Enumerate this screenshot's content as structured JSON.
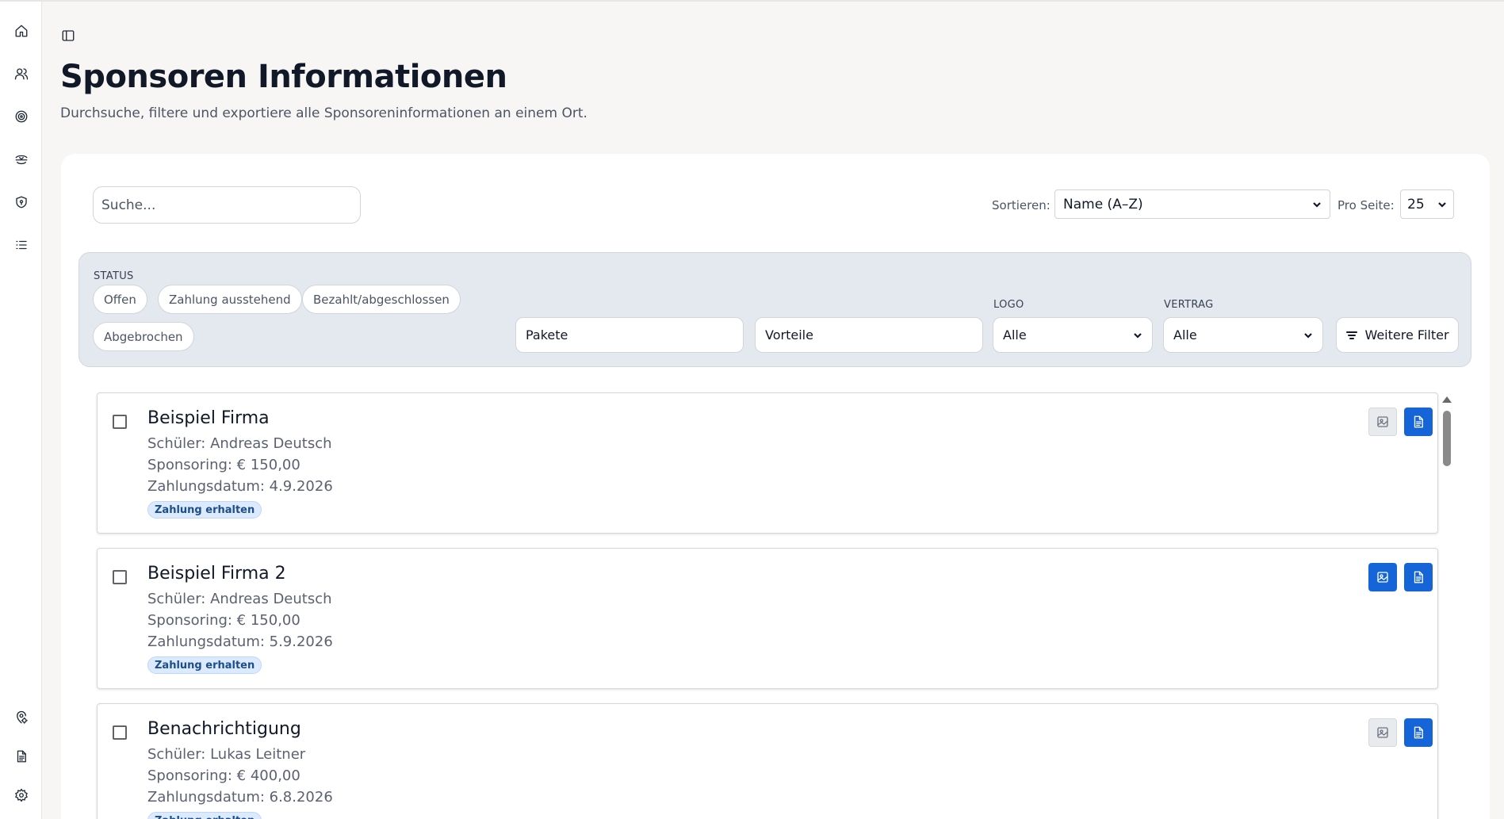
{
  "page": {
    "title": "Sponsoren Informationen",
    "subtitle": "Durchsuche, filtere und exportiere alle Sponsoreninformationen an einem Ort."
  },
  "sidebar": {
    "top_icons": [
      "home-icon",
      "users-icon",
      "target-icon",
      "handshake-icon",
      "shield-icon",
      "list-icon"
    ],
    "bottom_icons": [
      "location-settings-icon",
      "document-icon",
      "settings-icon"
    ]
  },
  "toolbar": {
    "search_placeholder": "Suche...",
    "sort_label": "Sortieren:",
    "sort_value": "Name (A–Z)",
    "per_page_label": "Pro Seite:",
    "per_page_value": "25"
  },
  "filters": {
    "status_label": "STATUS",
    "status_chips": [
      "Offen",
      "Zahlung ausstehend",
      "Bezahlt/abgeschlossen",
      "Abgebrochen"
    ],
    "pakete_value": "Pakete",
    "vorteile_value": "Vorteile",
    "logo_label": "LOGO",
    "logo_value": "Alle",
    "vertrag_label": "VERTRAG",
    "vertrag_value": "Alle",
    "more_filters_label": "Weitere Filter"
  },
  "sponsors": [
    {
      "name": "Beispiel Firma",
      "schueler": "Schüler: Andreas Deutsch",
      "sponsoring": "Sponsoring: € 150,00",
      "zahlungsdatum": "Zahlungsdatum: 4.9.2026",
      "badge": "Zahlung erhalten",
      "logo_action": "inactive"
    },
    {
      "name": "Beispiel Firma 2",
      "schueler": "Schüler: Andreas Deutsch",
      "sponsoring": "Sponsoring: € 150,00",
      "zahlungsdatum": "Zahlungsdatum: 5.9.2026",
      "badge": "Zahlung erhalten",
      "logo_action": "active"
    },
    {
      "name": "Benachrichtigung",
      "schueler": "Schüler: Lukas Leitner",
      "sponsoring": "Sponsoring: € 400,00",
      "zahlungsdatum": "Zahlungsdatum: 6.8.2026",
      "badge": "Zahlung erhalten",
      "logo_action": "inactive"
    }
  ],
  "colors": {
    "accent": "#1565d8",
    "badge_bg": "#dbeafe",
    "filter_bg": "#e4e8ef",
    "page_bg": "#f7f6f4"
  }
}
